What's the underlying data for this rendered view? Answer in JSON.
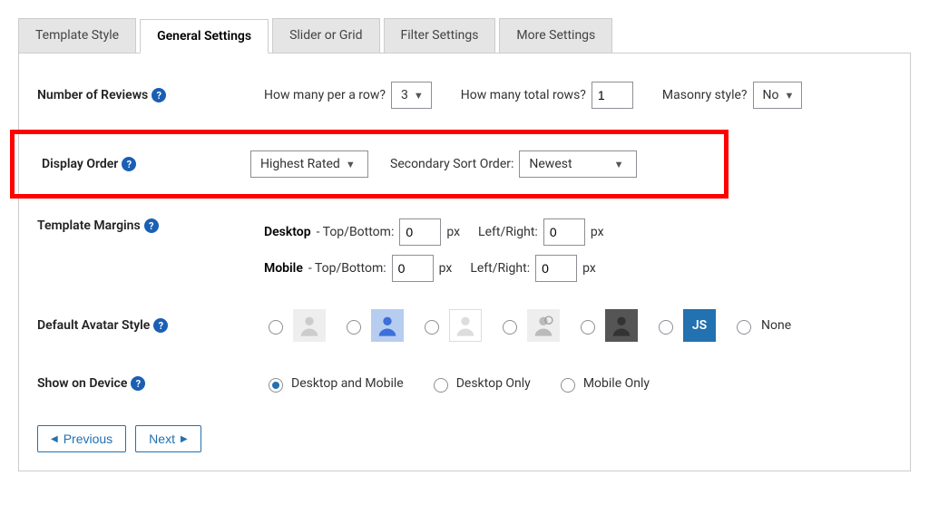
{
  "tabs": {
    "template_style": "Template Style",
    "general_settings": "General Settings",
    "slider_or_grid": "Slider or Grid",
    "filter_settings": "Filter Settings",
    "more_settings": "More Settings"
  },
  "num_reviews": {
    "label": "Number of Reviews",
    "per_row_label": "How many per a row?",
    "per_row_value": "3",
    "total_rows_label": "How many total rows?",
    "total_rows_value": "1",
    "masonry_label": "Masonry style?",
    "masonry_value": "No"
  },
  "display_order": {
    "label": "Display Order",
    "primary_value": "Highest Rated",
    "secondary_label": "Secondary Sort Order:",
    "secondary_value": "Newest"
  },
  "margins": {
    "label": "Template Margins",
    "desktop_prefix": "Desktop",
    "mobile_prefix": "Mobile",
    "tb_label": " - Top/Bottom:",
    "lr_label": "Left/Right:",
    "desktop_tb": "0",
    "desktop_lr": "0",
    "mobile_tb": "0",
    "mobile_lr": "0",
    "px": "px"
  },
  "avatar": {
    "label": "Default Avatar Style",
    "js_text": "JS",
    "none_label": "None"
  },
  "device": {
    "label": "Show on Device",
    "opt_both": "Desktop and Mobile",
    "opt_desktop": "Desktop Only",
    "opt_mobile": "Mobile Only"
  },
  "nav": {
    "prev": "Previous",
    "next": "Next"
  }
}
